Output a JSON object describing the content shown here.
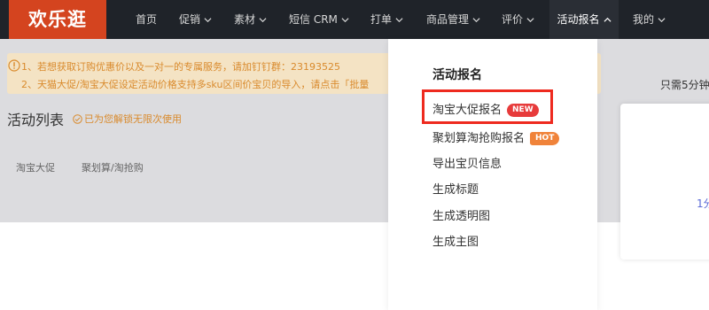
{
  "colors": {
    "brand": "#d4441f",
    "nav_bg": "#1f2329",
    "notice_text": "#d98a2c",
    "highlight": "#ee2a1f"
  },
  "header": {
    "logo": "欢乐逛",
    "nav": [
      {
        "label": "首页"
      },
      {
        "label": "促销"
      },
      {
        "label": "素材"
      },
      {
        "label": "短信 CRM"
      },
      {
        "label": "打单"
      },
      {
        "label": "商品管理"
      },
      {
        "label": "评价"
      },
      {
        "label": "活动报名"
      },
      {
        "label": "我的"
      }
    ]
  },
  "notice": {
    "line1": "1、若想获取订购优惠价以及一对一的专属服务，请加钉钉群：23193525",
    "line2": "2、天猫大促/淘宝大促设定活动价格支持多sku区间价宝贝的导入，请点击「批量"
  },
  "page": {
    "title": "活动列表",
    "unlock_text": "已为您解锁无限次使用"
  },
  "tabs": [
    {
      "label": "淘宝大促"
    },
    {
      "label": "聚划算/淘抢购"
    }
  ],
  "right_panel": {
    "text": "只需5分钟",
    "card_text": "1分"
  },
  "dropdown": {
    "heading": "活动报名",
    "items": [
      {
        "label": "淘宝大促报名",
        "badge": "NEW"
      },
      {
        "label": "聚划算淘抢购报名",
        "badge": "HOT"
      },
      {
        "label": "导出宝贝信息"
      },
      {
        "label": "生成标题"
      },
      {
        "label": "生成透明图"
      },
      {
        "label": "生成主图"
      }
    ]
  }
}
